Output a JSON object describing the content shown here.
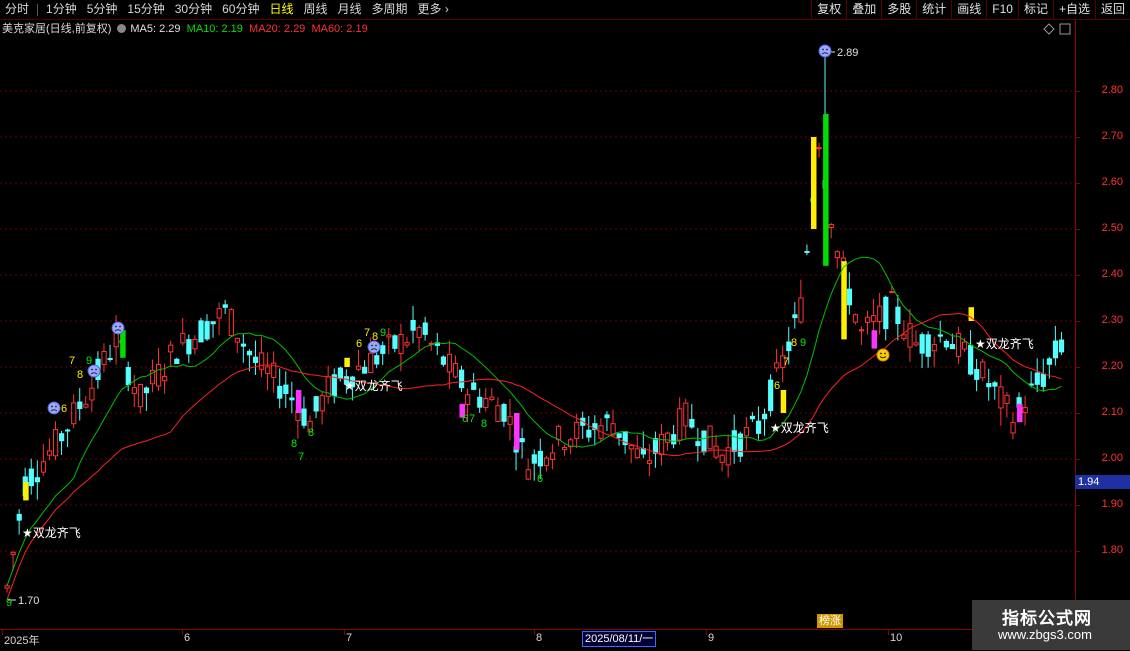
{
  "toolbar": {
    "periods": [
      "分时",
      "1分钟",
      "5分钟",
      "15分钟",
      "30分钟",
      "60分钟",
      "日线",
      "周线",
      "月线",
      "多周期",
      "更多"
    ],
    "active_period": "日线",
    "right_buttons": [
      "复权",
      "叠加",
      "多股",
      "统计",
      "画线",
      "F10",
      "标记",
      "+自选",
      "返回"
    ]
  },
  "info": {
    "title": "美克家居(日线,前复权)",
    "ma5": "MA5: 2.29",
    "ma10": "MA10: 2.19",
    "ma20": "MA20: 2.29",
    "ma60": "MA60: 2.19"
  },
  "colors": {
    "up": "#ff3232",
    "down": "#54ffff",
    "ma_green": "#00c000",
    "ma_red": "#ff2020",
    "signal_yellow": "#ffee00",
    "signal_green": "#00dd00",
    "signal_magenta": "#ff33ff"
  },
  "y_axis": {
    "labels": [
      "2.80",
      "2.70",
      "2.60",
      "2.50",
      "2.40",
      "2.30",
      "2.20",
      "2.10",
      "2.00",
      "1.90",
      "1.80"
    ]
  },
  "current_price": "1.94",
  "date_axis": {
    "labels": [
      "2025年",
      "6",
      "7",
      "8",
      "9",
      "10"
    ],
    "cursor_date": "2025/08/11/一"
  },
  "badge": "榜涨",
  "annotations": {
    "high": "2.89",
    "low": "1.70",
    "signal_text": "★双龙齐飞"
  },
  "watermark": {
    "line1": "指标公式网",
    "line2": "www.zbgs3.com"
  },
  "chart_data": {
    "type": "candlestick",
    "ylim": [
      1.7,
      2.9
    ],
    "high": 2.89,
    "low": 1.7,
    "ma_lines": [
      "MA5",
      "MA10",
      "MA20",
      "MA60"
    ]
  }
}
